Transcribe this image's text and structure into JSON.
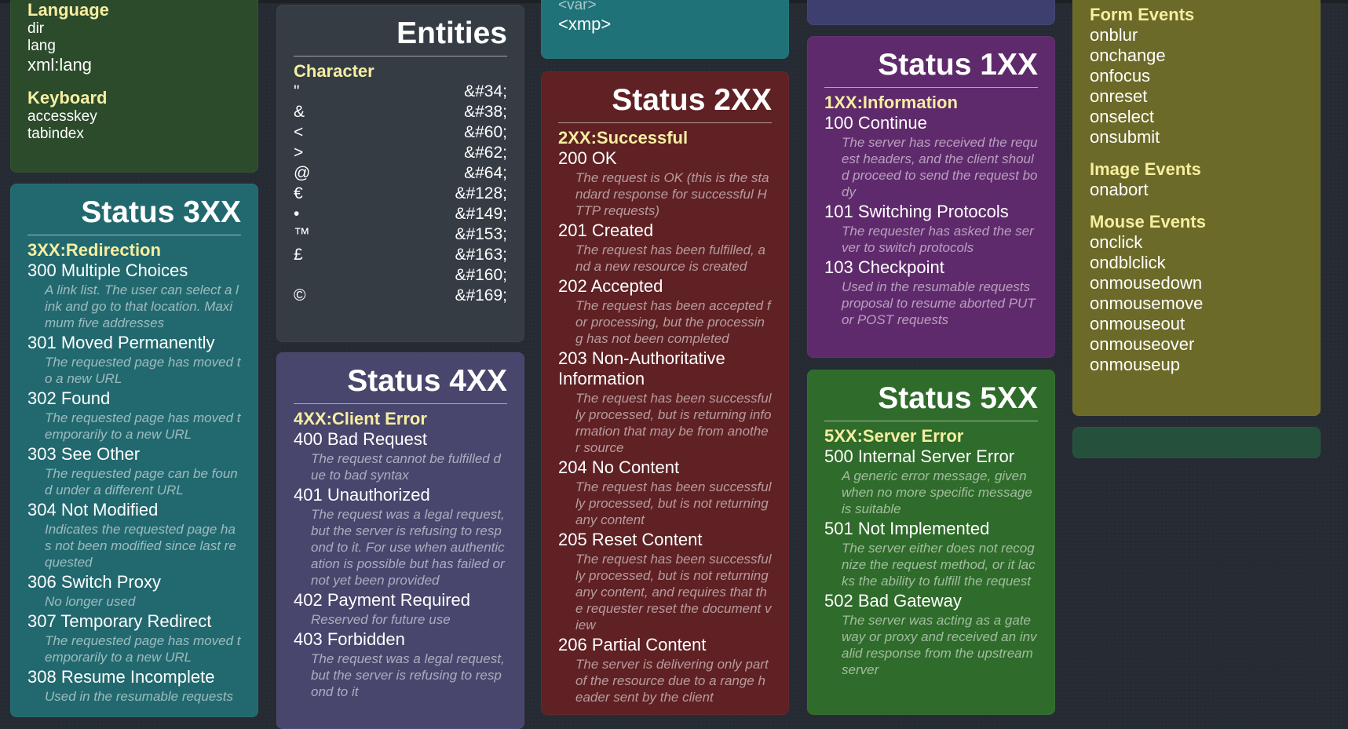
{
  "col1_top": {
    "partial_heading": "Language",
    "items1": [
      "dir",
      "lang"
    ],
    "xml": "xml:lang",
    "keyboard_heading": "Keyboard",
    "items2": [
      "accesskey",
      "tabindex"
    ]
  },
  "status3": {
    "title": "Status 3XX",
    "section": "3XX:Redirection",
    "entries": [
      {
        "code": "300 Multiple Choices",
        "desc": "A link list. The user can select a link and go to that location. Maximum five addresses"
      },
      {
        "code": "301 Moved Permanently",
        "desc": "The requested page has moved to a new URL"
      },
      {
        "code": "302 Found",
        "desc": "The requested page has moved temporarily to a new URL"
      },
      {
        "code": "303 See Other",
        "desc": "The requested page can be found under a different URL"
      },
      {
        "code": "304 Not Modified",
        "desc": "Indicates the requested page has not been modified since last requested"
      },
      {
        "code": "306 Switch Proxy",
        "desc": "No longer used"
      },
      {
        "code": "307 Temporary Redirect",
        "desc": "The requested page has moved temporarily to a new URL"
      },
      {
        "code": "308 Resume Incomplete",
        "desc": "Used in the resumable requests"
      }
    ]
  },
  "entities": {
    "title": "Entities",
    "section": "Character",
    "rows": [
      {
        "char": "\"",
        "code": "&#34;"
      },
      {
        "char": "&",
        "code": "&#38;"
      },
      {
        "char": "<",
        "code": "&#60;"
      },
      {
        "char": ">",
        "code": "&#62;"
      },
      {
        "char": "@",
        "code": "&#64;"
      },
      {
        "char": "€",
        "code": "&#128;"
      },
      {
        "char": "•",
        "code": "&#149;"
      },
      {
        "char": "™",
        "code": "&#153;"
      },
      {
        "char": "£",
        "code": "&#163;"
      },
      {
        "char": "",
        "code": "&#160;"
      },
      {
        "char": "©",
        "code": "&#169;"
      }
    ]
  },
  "status4": {
    "title": "Status 4XX",
    "section": "4XX:Client Error",
    "entries": [
      {
        "code": "400 Bad Request",
        "desc": "The request cannot be fulfilled due to bad syntax"
      },
      {
        "code": "401 Unauthorized",
        "desc": "The request was a legal request, but the server is refusing to respond to it. For use when authentication is possible but has failed or not yet been provided"
      },
      {
        "code": "402 Payment Required",
        "desc": "Reserved for future use"
      },
      {
        "code": "403 Forbidden",
        "desc": "The request was a legal request, but the server is refusing to respond to it"
      }
    ]
  },
  "col3_top": {
    "partial": "<var>",
    "xmp": "<xmp>"
  },
  "status2": {
    "title": "Status 2XX",
    "section": "2XX:Successful",
    "entries": [
      {
        "code": "200 OK",
        "desc": "The request is OK (this is the standard response for successful HTTP requests)"
      },
      {
        "code": "201 Created",
        "desc": "The request has been fulfilled, and a new resource is created"
      },
      {
        "code": "202 Accepted",
        "desc": "The request has been accepted for processing, but the processing has not been completed"
      },
      {
        "code": "203 Non-Authoritative Information",
        "desc": "The request has been successfully processed, but is returning information that may be from another source"
      },
      {
        "code": "204 No Content",
        "desc": "The request has been successfully processed, but is not returning any content"
      },
      {
        "code": "205 Reset Content",
        "desc": "The request has been successfully processed, but is not returning any content, and requires that the requester reset the document view"
      },
      {
        "code": "206 Partial Content",
        "desc": "The server is delivering only part of the resource due to a range header sent by the client"
      }
    ]
  },
  "status1": {
    "title": "Status 1XX",
    "section": "1XX:Information",
    "entries": [
      {
        "code": "100 Continue",
        "desc": "The server has received the request headers, and the client should proceed to send the request body"
      },
      {
        "code": "101 Switching Protocols",
        "desc": "The requester has asked the server to switch protocols"
      },
      {
        "code": "103 Checkpoint",
        "desc": "Used in the resumable requests proposal to resume aborted PUT or POST requests"
      }
    ]
  },
  "status5": {
    "title": "Status 5XX",
    "section": "5XX:Server Error",
    "entries": [
      {
        "code": "500 Internal Server Error",
        "desc": "A generic error message, given when no more specific message is suitable"
      },
      {
        "code": "501 Not Implemented",
        "desc": "The server either does not recognize the request method, or it lacks the ability to fulfill the request"
      },
      {
        "code": "502 Bad Gateway",
        "desc": "The server was acting as a gateway or proxy and received an invalid response from the upstream server"
      }
    ]
  },
  "events": {
    "form_heading": "Form Events",
    "form": [
      "onblur",
      "onchange",
      "onfocus",
      "onreset",
      "onselect",
      "onsubmit"
    ],
    "image_heading": "Image Events",
    "image": [
      "onabort"
    ],
    "mouse_heading": "Mouse Events",
    "mouse": [
      "onclick",
      "ondblclick",
      "onmousedown",
      "onmousemove",
      "onmouseout",
      "onmouseover",
      "onmouseup"
    ]
  }
}
